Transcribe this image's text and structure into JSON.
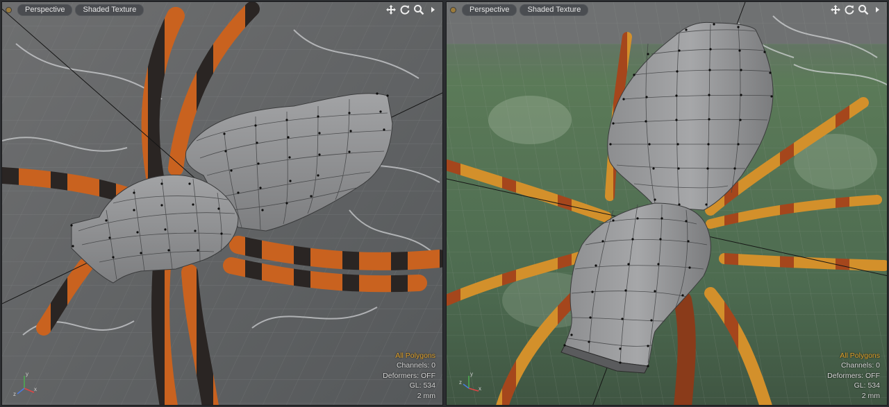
{
  "viewports": [
    {
      "view_mode": "Perspective",
      "shading_mode": "Shaded Texture",
      "info": {
        "selection": "All Polygons",
        "channels": "Channels: 0",
        "deformers": "Deformers: OFF",
        "gl": "GL: 534",
        "grid": "2 mm"
      },
      "axis": {
        "y": "y",
        "x": "x",
        "z": "z"
      }
    },
    {
      "view_mode": "Perspective",
      "shading_mode": "Shaded Texture",
      "info": {
        "selection": "All Polygons",
        "channels": "Channels: 0",
        "deformers": "Deformers: OFF",
        "gl": "GL: 534",
        "grid": "2 mm"
      },
      "axis": {
        "y": "y",
        "x": "x",
        "z": "z"
      }
    }
  ],
  "colors": {
    "accent": "#e0a12a",
    "mesh": "#8f9092",
    "vertex": "#111111",
    "leg_orange": "#c9621f",
    "leg_dark": "#2a2523"
  },
  "icons": [
    "pan-icon",
    "rotate-icon",
    "zoom-icon",
    "viewport-menu-icon"
  ]
}
